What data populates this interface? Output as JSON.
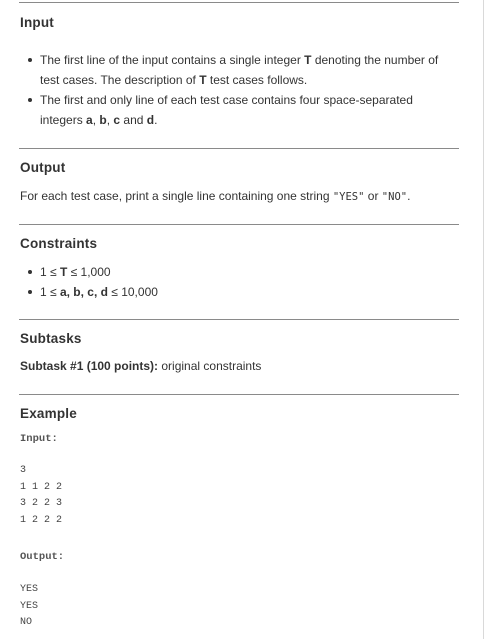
{
  "input": {
    "heading": "Input",
    "bullet1": {
      "pre": "The first line of the input contains a single integer ",
      "T": "T",
      "mid": " denoting the number of test cases. The description of ",
      "T2": "T",
      "post": " test cases follows."
    },
    "bullet2": {
      "pre": "The first and only line of each test case contains four space-separated integers ",
      "a": "a",
      "sep1": ", ",
      "b": "b",
      "sep2": ", ",
      "c": "c",
      "sep3": " and ",
      "d": "d",
      "post": "."
    }
  },
  "output": {
    "heading": "Output",
    "pre": "For each test case, print a single line containing one string ",
    "yes": "\"YES\"",
    "mid": " or ",
    "no": "\"NO\"",
    "post": "."
  },
  "constraints": {
    "heading": "Constraints",
    "c1": {
      "pre": "1 ≤ ",
      "T": "T",
      "post": " ≤ 1,000"
    },
    "c2": {
      "pre": "1 ≤ ",
      "vars": "a, b, c, d",
      "post": " ≤ 10,000"
    }
  },
  "subtasks": {
    "heading": "Subtasks",
    "label": "Subtask #1 (100 points):",
    "text": " original constraints"
  },
  "example": {
    "heading": "Example",
    "input_label": "Input:",
    "input_text": "3\n1 1 2 2\n3 2 2 3\n1 2 2 2",
    "output_label": "Output:",
    "output_text": "YES\nYES\nNO"
  }
}
